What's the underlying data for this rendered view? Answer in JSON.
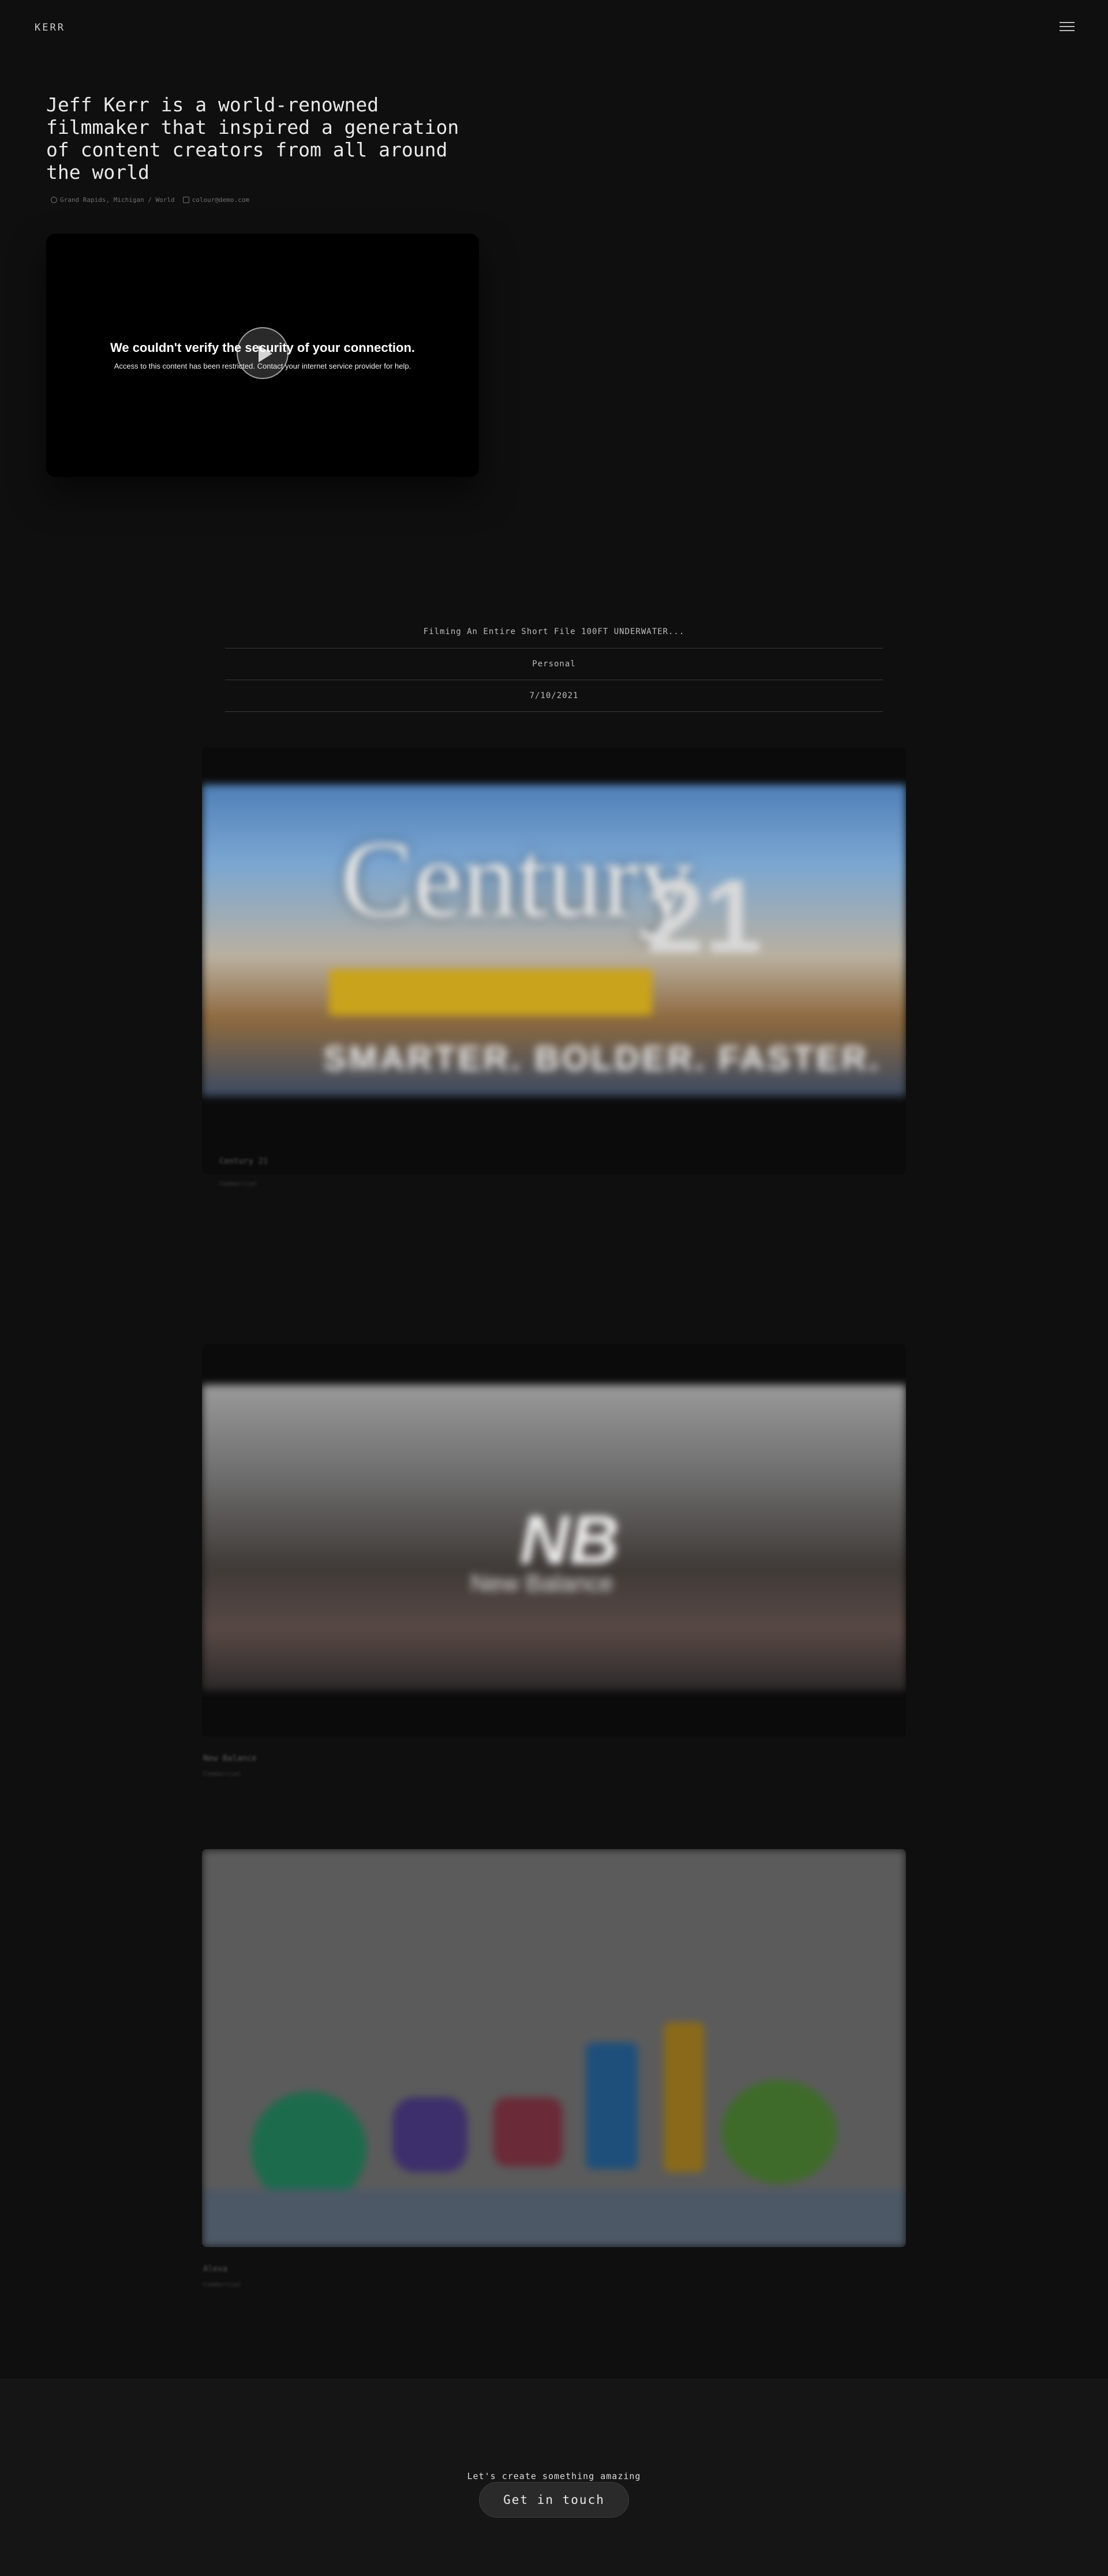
{
  "header": {
    "logo": "KERR",
    "menu_icon": "hamburger-menu-icon"
  },
  "hero": {
    "title": "Jeff Kerr is a world-renowned filmmaker that inspired a generation of content creators from all around the world",
    "location": "Grand Rapids, Michigan / World",
    "email": "colour@demo.com",
    "location_icon": "globe-icon",
    "email_icon": "mail-icon"
  },
  "video": {
    "error_title": "We couldn't verify the security of your connection.",
    "error_message": "Access to this content has been restricted. Contact your internet service provider for help.",
    "play_icon": "play-icon"
  },
  "featured": {
    "title": "Filming An Entire Short File 100FT UNDERWATER...",
    "category": "Personal",
    "date": "7/10/2021"
  },
  "projects": [
    {
      "thumb_text": [
        "Century",
        "21",
        "SMARTER. BOLDER. FASTER."
      ],
      "label": "Century 21",
      "sub": "Commercial"
    },
    {
      "thumb_text": [
        "NB",
        "New Balance"
      ],
      "label": "New Balance",
      "sub": "Commercial"
    },
    {
      "label": "Alexa",
      "sub": "Commercial"
    }
  ],
  "footer": {
    "cta_text": "Let's create something amazing",
    "cta_button": "Get in touch"
  }
}
